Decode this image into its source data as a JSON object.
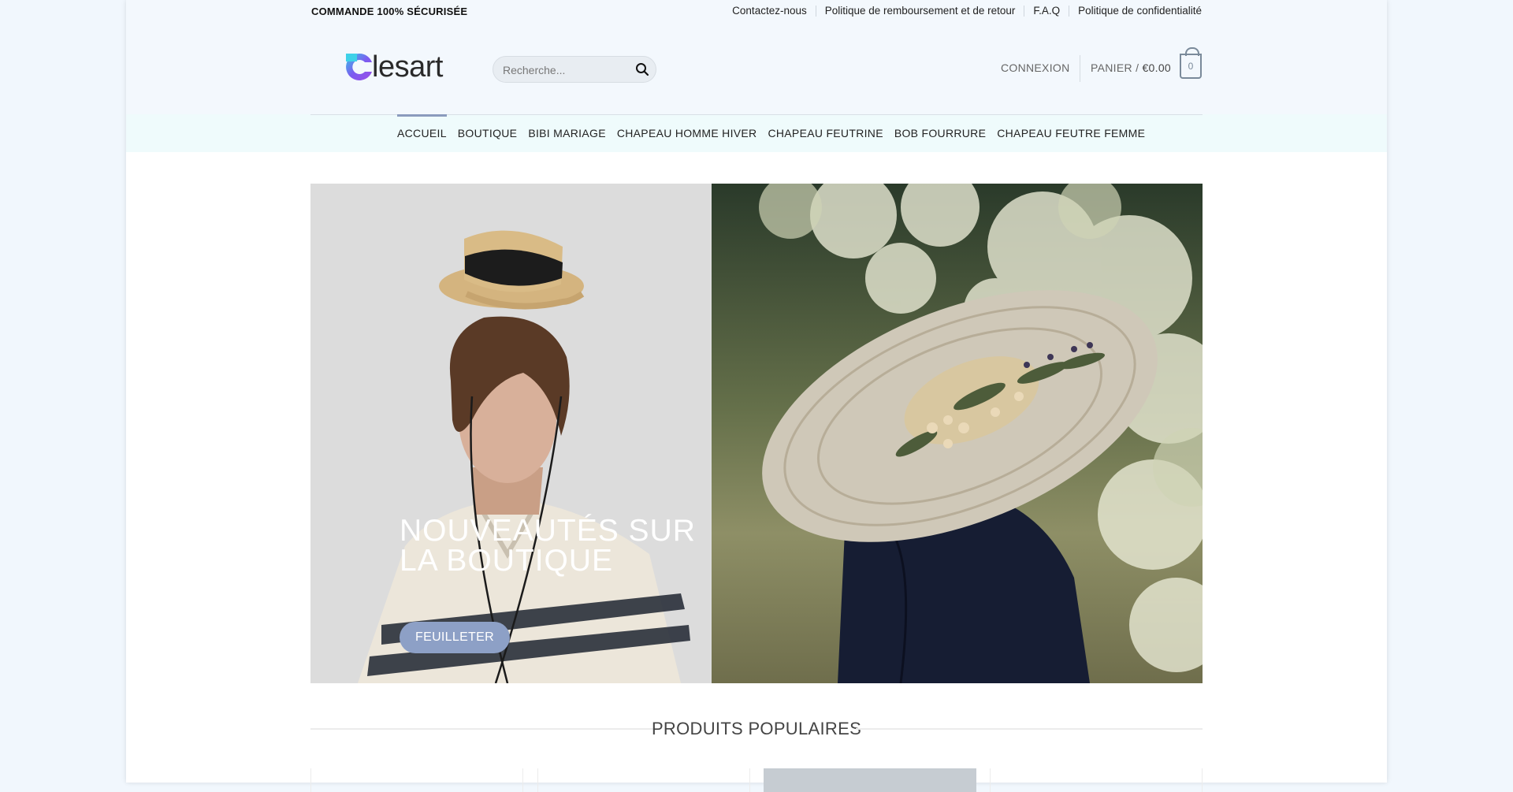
{
  "topbar": {
    "secure_label": "COMMANDE 100% SÉCURISÉE",
    "links": [
      {
        "label": "Contactez-nous"
      },
      {
        "label": "Politique de remboursement et de retour"
      },
      {
        "label": "F.A.Q"
      },
      {
        "label": "Politique de confidentialité"
      }
    ]
  },
  "header": {
    "logo_text": "lesart",
    "logo_letter": "C",
    "search": {
      "placeholder": "Recherche...",
      "value": ""
    },
    "account_label": "CONNEXION",
    "cart": {
      "label": "PANIER / ",
      "amount": "€0.00",
      "count": "0"
    }
  },
  "nav": {
    "items": [
      {
        "label": "ACCUEIL",
        "active": true
      },
      {
        "label": "BOUTIQUE"
      },
      {
        "label": "BIBI MARIAGE"
      },
      {
        "label": "CHAPEAU HOMME HIVER"
      },
      {
        "label": "CHAPEAU FEUTRINE"
      },
      {
        "label": "BOB FOURRURE"
      },
      {
        "label": "CHAPEAU FEUTRE FEMME"
      }
    ]
  },
  "hero": {
    "title": "NOUVEAUTÉS SUR LA BOUTIQUE",
    "button_label": "FEUILLETER"
  },
  "section": {
    "title": "PRODUITS POPULAIRES"
  },
  "colors": {
    "accent": "#8da0c6",
    "page_bg": "#f1f7fd",
    "nav_bg": "#effbfc"
  },
  "icons": [
    "search-icon",
    "cart-icon",
    "logo-icon"
  ]
}
